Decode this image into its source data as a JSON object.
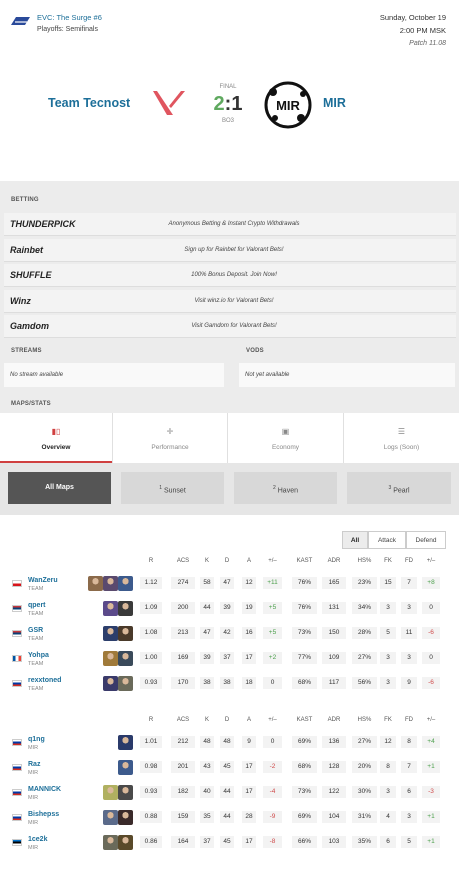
{
  "event": {
    "title": "EVC: The Surge #6",
    "stage": "Playoffs: Semifinals",
    "date": "Sunday, October 19",
    "time": "2:00 PM MSK",
    "patch": "Patch 11.08"
  },
  "match": {
    "team1": "Team Tecnost",
    "team2": "MIR",
    "status": "FINAL",
    "score1": "2",
    "score_sep": ":",
    "score2": "1",
    "format": "BO3",
    "team2_logo_text": "MIR"
  },
  "betting": {
    "label": "BETTING",
    "items": [
      {
        "name": "THUNDERPICK",
        "text": "Anonymous Betting & Instant Crypto Withdrawals"
      },
      {
        "name": "Rainbet",
        "text": "Sign up for Rainbet for Valorant Bets!"
      },
      {
        "name": "SHUFFLE",
        "text": "100% Bonus Deposit. Join Now!"
      },
      {
        "name": "Winz",
        "text": "Visit winz.io for Valorant Bets!"
      },
      {
        "name": "Gamdom",
        "text": "Visit Gamdom for Valorant Bets!"
      }
    ]
  },
  "streams": {
    "label": "STREAMS",
    "text": "No stream available"
  },
  "vods": {
    "label": "VODS",
    "text": "Not yet available"
  },
  "maps_stats_label": "MAPS/STATS",
  "tabs": [
    {
      "label": "Overview",
      "icon": "bar-chart-icon"
    },
    {
      "label": "Performance",
      "icon": "crosshair-icon"
    },
    {
      "label": "Economy",
      "icon": "money-icon"
    },
    {
      "label": "Logs (Soon)",
      "icon": "list-icon"
    }
  ],
  "maps": [
    {
      "num": "",
      "name": "All Maps"
    },
    {
      "num": "1",
      "name": "Sunset"
    },
    {
      "num": "2",
      "name": "Haven"
    },
    {
      "num": "3",
      "name": "Pearl"
    }
  ],
  "filters": [
    "All",
    "Attack",
    "Defend"
  ],
  "columns": [
    "R",
    "ACS",
    "K",
    "D",
    "A",
    "+/–",
    "KAST",
    "ADR",
    "HS%",
    "FK",
    "FD",
    "+/–"
  ],
  "teams": [
    {
      "players": [
        {
          "name": "WanZeru",
          "team": "TEAM",
          "flag": "cz",
          "agents": [
            "#8b6a4a",
            "#5a4a6e",
            "#3c5a8c"
          ],
          "r": "1.12",
          "acs": "274",
          "k": "58",
          "d": "47",
          "a": "12",
          "kd": "+11",
          "kast": "76%",
          "adr": "165",
          "hs": "23%",
          "fk": "15",
          "fd": "7",
          "fkd": "+8"
        },
        {
          "name": "qpert",
          "team": "TEAM",
          "flag": "rs",
          "agents": [
            "#5b4a8a",
            "#3a3a3a"
          ],
          "r": "1.09",
          "acs": "200",
          "k": "44",
          "d": "39",
          "a": "19",
          "kd": "+5",
          "kast": "76%",
          "adr": "131",
          "hs": "34%",
          "fk": "3",
          "fd": "3",
          "fkd": "0"
        },
        {
          "name": "GSR",
          "team": "TEAM",
          "flag": "rs",
          "agents": [
            "#2c3e6b",
            "#4a3a2a"
          ],
          "r": "1.08",
          "acs": "213",
          "k": "47",
          "d": "42",
          "a": "16",
          "kd": "+5",
          "kast": "73%",
          "adr": "150",
          "hs": "28%",
          "fk": "5",
          "fd": "11",
          "fkd": "-6"
        },
        {
          "name": "Yohpa",
          "team": "TEAM",
          "flag": "fr",
          "agents": [
            "#a07a3a",
            "#3a4a5a"
          ],
          "r": "1.00",
          "acs": "169",
          "k": "39",
          "d": "37",
          "a": "17",
          "kd": "+2",
          "kast": "77%",
          "adr": "109",
          "hs": "27%",
          "fk": "3",
          "fd": "3",
          "fkd": "0"
        },
        {
          "name": "rexxtoned",
          "team": "TEAM",
          "flag": "ru",
          "agents": [
            "#3a3a6a",
            "#6a6a5a"
          ],
          "r": "0.93",
          "acs": "170",
          "k": "38",
          "d": "38",
          "a": "18",
          "kd": "0",
          "kast": "68%",
          "adr": "117",
          "hs": "56%",
          "fk": "3",
          "fd": "9",
          "fkd": "-6"
        }
      ]
    },
    {
      "players": [
        {
          "name": "q1ng",
          "team": "MIR",
          "flag": "ru",
          "agents": [
            "#2a3a6a"
          ],
          "r": "1.01",
          "acs": "212",
          "k": "48",
          "d": "48",
          "a": "9",
          "kd": "0",
          "kast": "69%",
          "adr": "136",
          "hs": "27%",
          "fk": "12",
          "fd": "8",
          "fkd": "+4"
        },
        {
          "name": "Raz",
          "team": "MIR",
          "flag": "ru",
          "agents": [
            "#3c5a8c"
          ],
          "r": "0.98",
          "acs": "201",
          "k": "43",
          "d": "45",
          "a": "17",
          "kd": "-2",
          "kast": "68%",
          "adr": "128",
          "hs": "20%",
          "fk": "8",
          "fd": "7",
          "fkd": "+1"
        },
        {
          "name": "MANNICK",
          "team": "MIR",
          "flag": "ru",
          "agents": [
            "#b0b060",
            "#4a4a4a"
          ],
          "r": "0.93",
          "acs": "182",
          "k": "40",
          "d": "44",
          "a": "17",
          "kd": "-4",
          "kast": "73%",
          "adr": "122",
          "hs": "30%",
          "fk": "3",
          "fd": "6",
          "fkd": "-3"
        },
        {
          "name": "Bishepss",
          "team": "MIR",
          "flag": "ru",
          "agents": [
            "#5a6a8a",
            "#3a2a2a"
          ],
          "r": "0.88",
          "acs": "159",
          "k": "35",
          "d": "44",
          "a": "28",
          "kd": "-9",
          "kast": "69%",
          "adr": "104",
          "hs": "31%",
          "fk": "4",
          "fd": "3",
          "fkd": "+1"
        },
        {
          "name": "1ce2k",
          "team": "MIR",
          "flag": "ee",
          "agents": [
            "#6a6a5a",
            "#5a4a2a"
          ],
          "r": "0.86",
          "acs": "164",
          "k": "37",
          "d": "45",
          "a": "17",
          "kd": "-8",
          "kast": "66%",
          "adr": "103",
          "hs": "35%",
          "fk": "6",
          "fd": "5",
          "fkd": "+1"
        }
      ]
    }
  ]
}
